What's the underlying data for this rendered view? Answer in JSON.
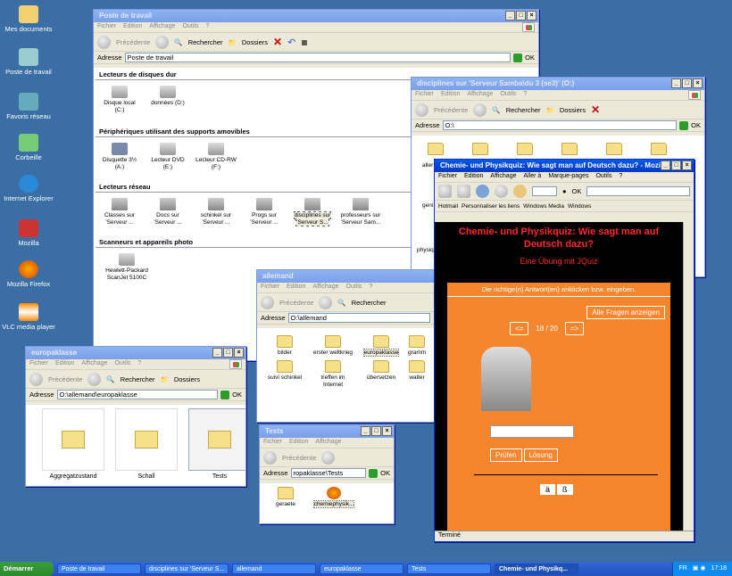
{
  "desktop": {
    "icons": [
      "Mes documents",
      "Poste de travail",
      "Favoris réseau",
      "Corbeille",
      "Internet Explorer",
      "Mozilla",
      "Mozilla Firefox",
      "VLC media player"
    ]
  },
  "menus": {
    "explorer": [
      "Fichier",
      "Edition",
      "Affichage",
      "Outils",
      "?"
    ],
    "firefox": [
      "Fichier",
      "Édition",
      "Affichage",
      "Aller à",
      "Marque-pages",
      "Outils",
      "?"
    ]
  },
  "toolbar": {
    "back": "Précédente",
    "search": "Rechercher",
    "folders": "Dossiers",
    "address_label": "Adresse",
    "go": "OK"
  },
  "poste": {
    "title": "Poste de travail",
    "address": "Poste de travail",
    "sections": [
      {
        "title": "Lecteurs de disques dur",
        "items": [
          "Disque local (C:)",
          "données (D:)"
        ]
      },
      {
        "title": "Périphériques utilisant des supports amovibles",
        "items": [
          "Disquette 3½ (A:)",
          "Lecteur DVD (E:)",
          "Lecteur CD-RW (F:)"
        ]
      },
      {
        "title": "Lecteurs réseau",
        "items": [
          "Classes sur 'Serveur ...",
          "Docs sur 'Serveur ...",
          "schinkel sur 'Serveur ...",
          "Progs sur 'Serveur ...",
          "disciplines sur 'Serveur S...",
          "professeurs sur 'Serveur Sam..."
        ]
      },
      {
        "title": "Scanneurs et appareils photo",
        "items": [
          "Hewlett-Packard ScanJet 5100C"
        ]
      }
    ]
  },
  "disciplines": {
    "title": "disciplines sur 'Serveur Samba\\du 3 (se3)' (O:)",
    "address": "O:\\",
    "side_labels": [
      "aller",
      "geni",
      "physiq"
    ]
  },
  "allemand": {
    "title": "allemand",
    "address": "O:\\allemand",
    "items": [
      "bilder",
      "erster weltkrieg",
      "europaklasse",
      "grammat",
      "suivi schinkel",
      "treffen im Internet",
      "übersetzen",
      "walter"
    ]
  },
  "europa": {
    "title": "europaklasse",
    "address": "O:\\allemand\\europaklasse",
    "items": [
      "Aggregatzustand",
      "Schall",
      "Tests"
    ]
  },
  "tests": {
    "title": "Tests",
    "address": "ropaklasse\\Tests",
    "items": [
      "geraete",
      "chemiephysik..."
    ]
  },
  "firefox": {
    "title": "Chemie- und Physikquiz: Wie sagt man auf Deutsch dazu? - Mozilla...",
    "bookmarks": [
      "Hotmail",
      "Personnaliser les liens",
      "Windows Media",
      "Windows"
    ],
    "status": "Terminé",
    "quiz": {
      "title": "Chemie- und Physikquiz: Wie sagt man auf Deutsch dazu?",
      "subtitle": "Eine Übung mit JQuiz",
      "instruction": "Die richtige(n) Antwort(en) anklicken bzw. eingeben.",
      "show_all": "Alle Fragen anzeigen",
      "prev": "<=",
      "counter": "18 / 20",
      "next": "=>",
      "check": "Prüfen",
      "hint": "Lösung",
      "char1": "ä",
      "char2": "ß"
    }
  },
  "taskbar": {
    "start": "Démarrer",
    "tasks": [
      "Poste de travail",
      "disciplines sur 'Serveur S...",
      "allemand",
      "europaklasse",
      "Tests",
      "Chemie- und Physikq..."
    ],
    "lang": "FR",
    "time": "17:18"
  },
  "colors": {
    "desktop": "#3a6ea5",
    "quiz_bg": "#f5862e",
    "quiz_title": "#ff2a2a"
  }
}
